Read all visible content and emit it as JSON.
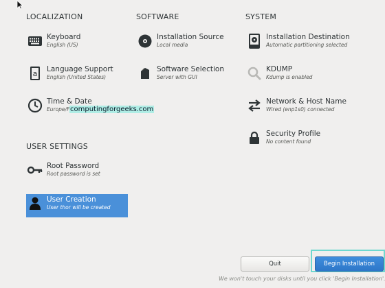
{
  "sections": {
    "localization": "LOCALIZATION",
    "software": "SOFTWARE",
    "system": "SYSTEM",
    "user_settings": "USER SETTINGS"
  },
  "localization": {
    "keyboard": {
      "title": "Keyboard",
      "status": "English (US)",
      "icon": "keyboard-icon"
    },
    "language": {
      "title": "Language Support",
      "status": "English (United States)",
      "icon": "language-icon"
    },
    "time": {
      "title": "Time & Date",
      "status": "Europe/F",
      "icon": "clock-icon"
    }
  },
  "software": {
    "source": {
      "title": "Installation Source",
      "status": "Local media",
      "icon": "disc-icon"
    },
    "selection": {
      "title": "Software Selection",
      "status": "Server with GUI",
      "icon": "package-icon"
    }
  },
  "system": {
    "destination": {
      "title": "Installation Destination",
      "status": "Automatic partitioning selected",
      "icon": "disk-icon"
    },
    "kdump": {
      "title": "KDUMP",
      "status": "Kdump is enabled",
      "icon": "magnifier-icon"
    },
    "network": {
      "title": "Network & Host Name",
      "status": "Wired (enp1s0) connected",
      "icon": "network-arrows-icon"
    },
    "security": {
      "title": "Security Profile",
      "status": "No content found",
      "icon": "lock-icon"
    }
  },
  "user_settings": {
    "root": {
      "title": "Root Password",
      "status": "Root password is set",
      "icon": "key-icon"
    },
    "user": {
      "title": "User Creation",
      "status": "User thor will be created",
      "icon": "user-icon"
    }
  },
  "watermark": "computingforgeeks.com",
  "buttons": {
    "quit": "Quit",
    "begin": "Begin Installation"
  },
  "footer_note": "We won't touch your disks until you click 'Begin Installation'.",
  "colors": {
    "selected": "#4a90d9",
    "begin_button": "#3584e4",
    "highlight_frame": "#6fd8cf"
  }
}
